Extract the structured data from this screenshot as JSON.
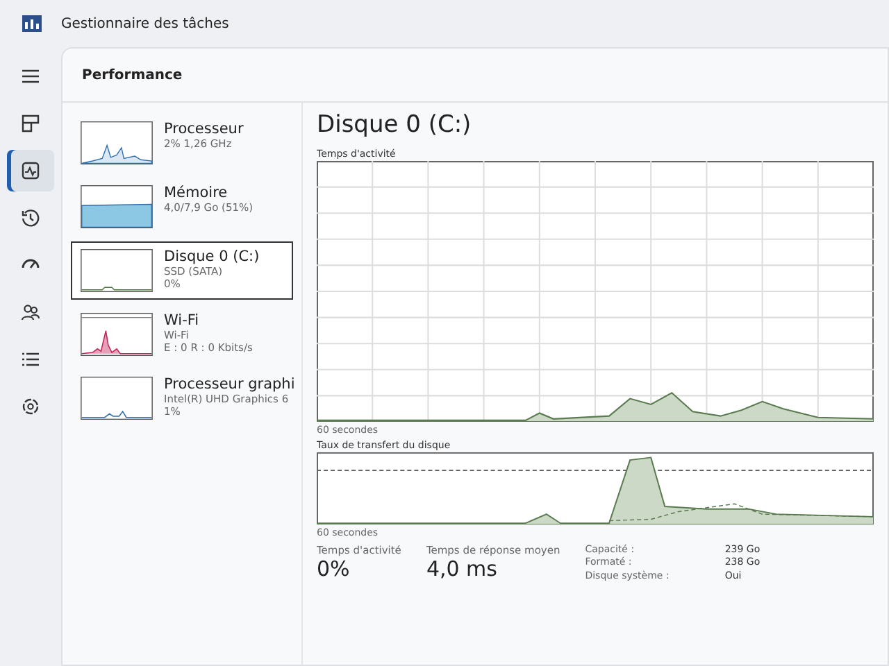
{
  "window": {
    "title": "Gestionnaire des tâches"
  },
  "nav": [
    {
      "kind": "menu",
      "selected": false
    },
    {
      "kind": "processes",
      "selected": false
    },
    {
      "kind": "performance",
      "selected": true
    },
    {
      "kind": "history",
      "selected": false
    },
    {
      "kind": "startup",
      "selected": false
    },
    {
      "kind": "users",
      "selected": false
    },
    {
      "kind": "details",
      "selected": false
    },
    {
      "kind": "services",
      "selected": false
    }
  ],
  "page_title": "Performance",
  "devices": [
    {
      "kind": "cpu",
      "name": "Processeur",
      "lines": [
        "2% 1,26 GHz"
      ],
      "selected": false
    },
    {
      "kind": "memory",
      "name": "Mémoire",
      "lines": [
        "4,0/7,9 Go (51%)"
      ],
      "selected": false
    },
    {
      "kind": "disk",
      "name": "Disque 0 (C:)",
      "lines": [
        "SSD (SATA)",
        "0%"
      ],
      "selected": true
    },
    {
      "kind": "wifi",
      "name": "Wi-Fi",
      "lines": [
        "Wi-Fi",
        "E : 0 R : 0 Kbits/s"
      ],
      "selected": false
    },
    {
      "kind": "gpu",
      "name": "Processeur graphi",
      "lines": [
        "Intel(R) UHD Graphics 6",
        "1%"
      ],
      "selected": false
    }
  ],
  "detail": {
    "title": "Disque 0 (C:)",
    "activity_label": "Temps d'activité",
    "activity_axis": "60 secondes",
    "transfer_label": "Taux de transfert du disque",
    "transfer_axis": "60 secondes",
    "stats": [
      {
        "label": "Temps d'activité",
        "value": "0%"
      },
      {
        "label": "Temps de réponse moyen",
        "value": "4,0 ms"
      }
    ],
    "properties": [
      {
        "label": "Capacité :",
        "value": "239 Go"
      },
      {
        "label": "Formaté :",
        "value": "238 Go"
      },
      {
        "label": "Disque système :",
        "value": "Oui"
      }
    ]
  }
}
